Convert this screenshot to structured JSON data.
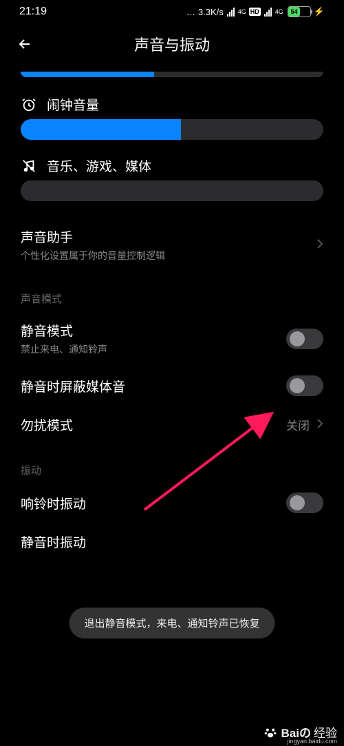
{
  "status": {
    "time": "21:19",
    "speed": "3.3K/s",
    "net1": "4G",
    "hd": "HD",
    "net2": "4G",
    "battery_pct": 54,
    "battery_text": "54"
  },
  "header": {
    "title": "声音与振动"
  },
  "sliders": {
    "top_partial_pct": 44,
    "alarm": {
      "label": "闹钟音量",
      "pct": 53
    },
    "media": {
      "label": "音乐、游戏、媒体",
      "pct": 0
    }
  },
  "assistant": {
    "title": "声音助手",
    "sub": "个性化设置属于你的音量控制逻辑"
  },
  "sections": {
    "mode_header": "声音模式",
    "silent": {
      "title": "静音模式",
      "sub": "禁止来电、通知铃声",
      "on": false
    },
    "mute_media": {
      "title": "静音时屏蔽媒体音",
      "on": false
    },
    "dnd": {
      "title": "勿扰模式",
      "value": "关闭"
    },
    "vibration_header": "振动",
    "vib_ring": {
      "title": "响铃时振动",
      "on": false
    },
    "vib_silent": {
      "title": "静音时振动"
    }
  },
  "toast": "退出静音模式，来电、通知铃声已恢复",
  "watermark": {
    "brand": "Baiの",
    "label": "经验",
    "url": "jingyan.baidu.com"
  }
}
